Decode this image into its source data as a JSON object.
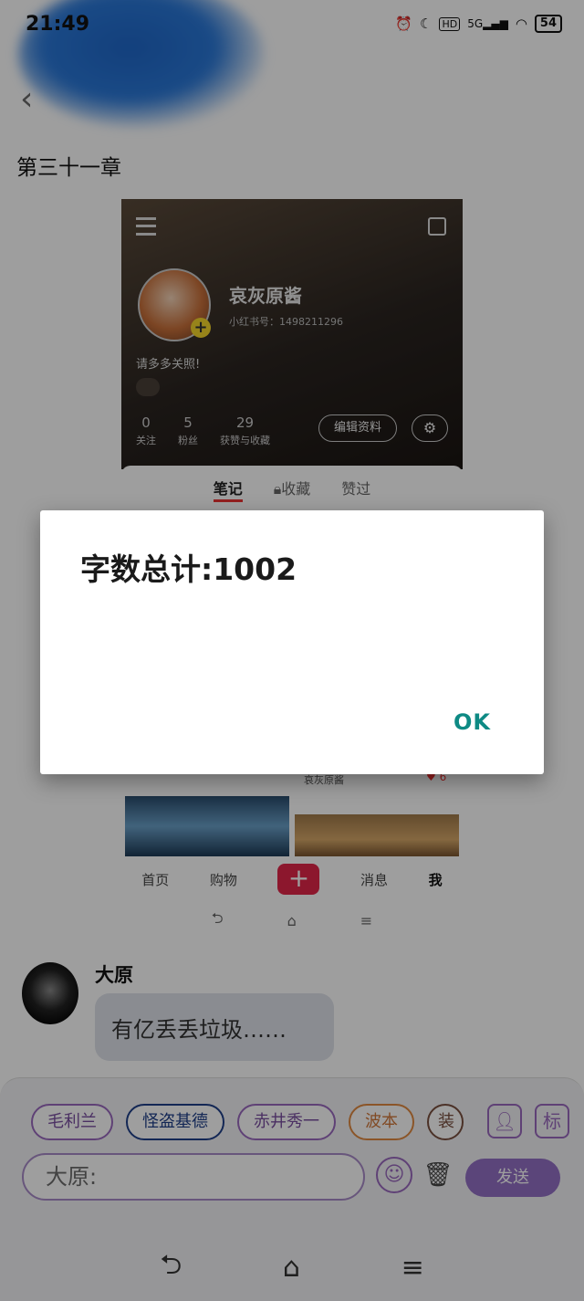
{
  "status_bar": {
    "time": "21:49",
    "icons": [
      "alarm-icon",
      "moon-icon",
      "hd-icon",
      "5g-signal-icon",
      "wifi-icon"
    ],
    "battery": "54"
  },
  "header": {
    "back_icon": "chevron-left-icon",
    "chapter_title": "第三十一章"
  },
  "embedded_screenshot": {
    "profile_name": "哀灰原酱",
    "profile_id": "小红书号：1498211296",
    "bio": "请多多关照!",
    "stats": [
      {
        "num": "0",
        "label": "关注"
      },
      {
        "num": "5",
        "label": "粉丝"
      },
      {
        "num": "29",
        "label": "获赞与收藏"
      }
    ],
    "edit_label": "编辑资料",
    "tabs": [
      "笔记",
      "收藏",
      "赞过"
    ],
    "feed_author": "哀灰原酱",
    "feed_likes": "6",
    "nav": [
      "首页",
      "购物",
      "+",
      "消息",
      "我"
    ]
  },
  "chat": {
    "sender": "大原",
    "message": "有亿丢丢垃圾……"
  },
  "bottom": {
    "chips": [
      "毛利兰",
      "怪盗基德",
      "赤井秀一",
      "波本",
      "装"
    ],
    "person_icon": "person-icon",
    "tag_label": "标",
    "input_value": "大原:",
    "send_label": "发送"
  },
  "dialog": {
    "message": "字数总计:1002",
    "ok_label": "OK"
  },
  "colors": {
    "accent_purple": "#9470c6",
    "ok_teal": "#0e8a84",
    "red_plus": "#e3264a"
  }
}
